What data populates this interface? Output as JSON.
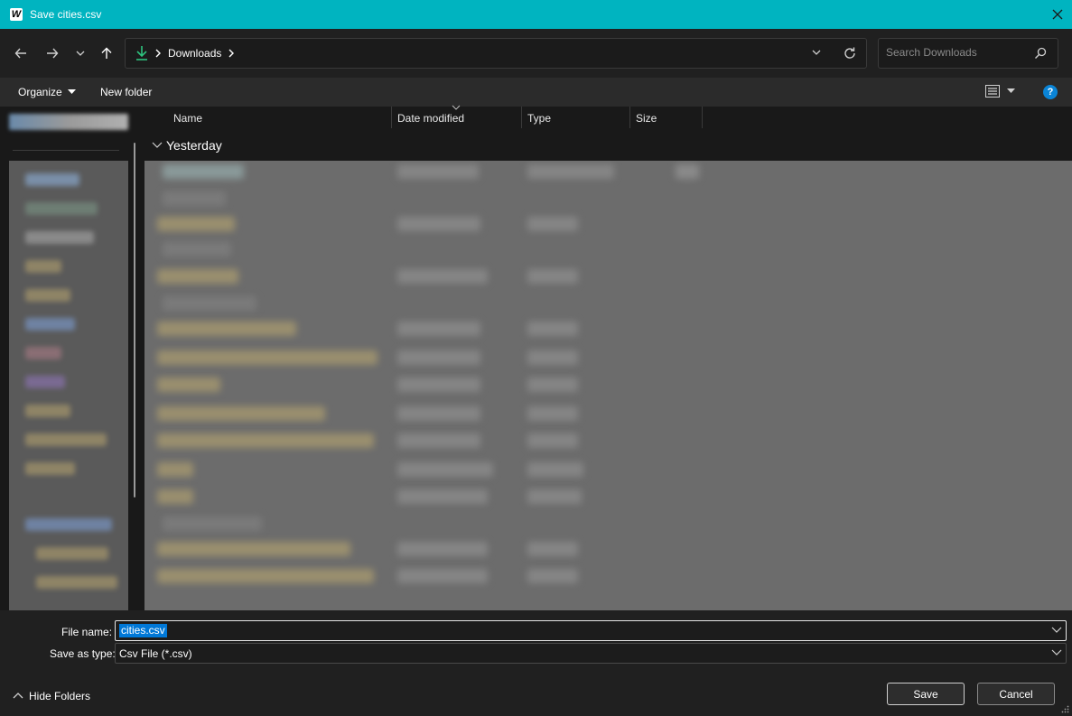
{
  "window": {
    "title": "Save cities.csv",
    "app_icon_letter": "W",
    "accent": "#00b4c0"
  },
  "nav": {
    "address_crumb": "Downloads",
    "search_placeholder": "Search Downloads",
    "icons": [
      "back-arrow-icon",
      "forward-arrow-icon",
      "recent-chevron-icon",
      "up-arrow-icon",
      "downloads-icon",
      "refresh-icon",
      "search-icon"
    ]
  },
  "commandbar": {
    "organize": "Organize",
    "new_folder": "New folder",
    "help": "?"
  },
  "columns": {
    "name": "Name",
    "date_modified": "Date modified",
    "type": "Type",
    "size": "Size"
  },
  "group": {
    "label": "Yesterday"
  },
  "footer": {
    "file_name_label": "File name:",
    "file_name_value": "cities.csv",
    "save_type_label": "Save as type:",
    "save_type_value": "Csv File (*.csv)",
    "hide_folders": "Hide Folders",
    "save": "Save",
    "cancel": "Cancel",
    "highlight_color": "#0078d7"
  }
}
